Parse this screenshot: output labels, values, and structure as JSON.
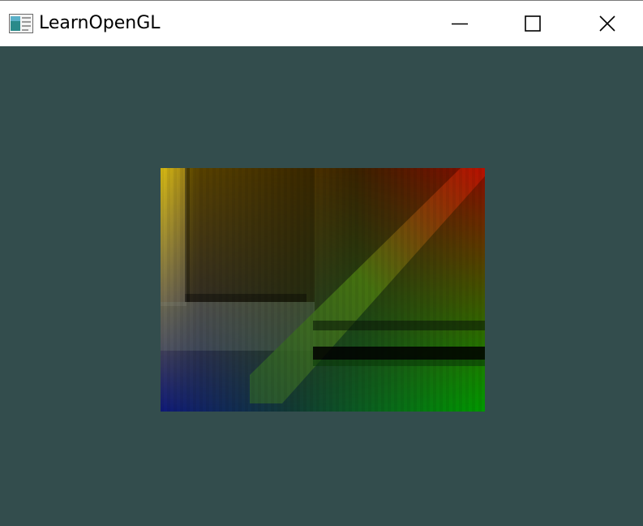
{
  "window": {
    "title": "LearnOpenGL",
    "icon": "opengl-app-icon",
    "buttons": {
      "minimize_icon": "minimize-icon",
      "maximize_icon": "maximize-icon",
      "close_icon": "close-icon"
    }
  },
  "viewport": {
    "clear_color": "#334d4d",
    "quad": {
      "corner_colors": {
        "top_left": "#ffff00",
        "top_right": "#ff0000",
        "bottom_left": "#0000ff",
        "bottom_right": "#00ff00"
      }
    }
  }
}
